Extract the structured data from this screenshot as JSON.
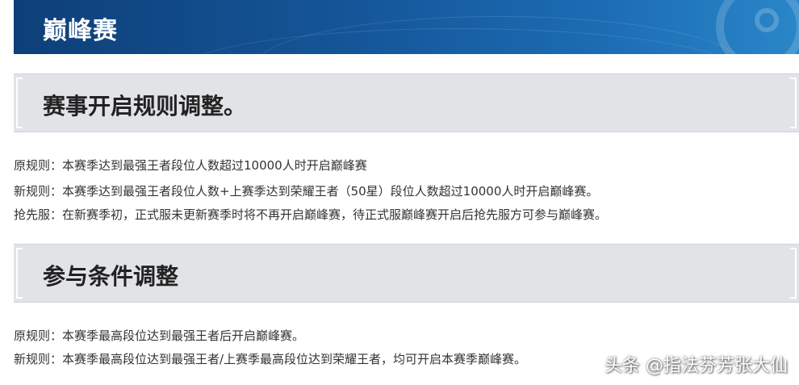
{
  "header": {
    "title": "巅峰赛"
  },
  "sections": [
    {
      "heading": "赛事开启规则调整。",
      "lines": [
        "原规则：本赛季达到最强王者段位人数超过10000人时开启巅峰赛",
        "新规则：本赛季达到最强王者段位人数+上赛季达到荣耀王者（50星）段位人数超过10000人时开启巅峰赛。",
        "抢先服：在新赛季初，正式服未更新赛季时将不再开启巅峰赛，待正式服巅峰赛开启后抢先服方可参与巅峰赛。"
      ]
    },
    {
      "heading": "参与条件调整",
      "lines": [
        "原规则：本赛季最高段位达到最强王者后开启巅峰赛。",
        "新规则：本赛季最高段位达到最强王者/上赛季最高段位达到荣耀王者，均可开启本赛季巅峰赛。"
      ]
    }
  ],
  "watermark": "头条 @指法芬芳张大仙"
}
